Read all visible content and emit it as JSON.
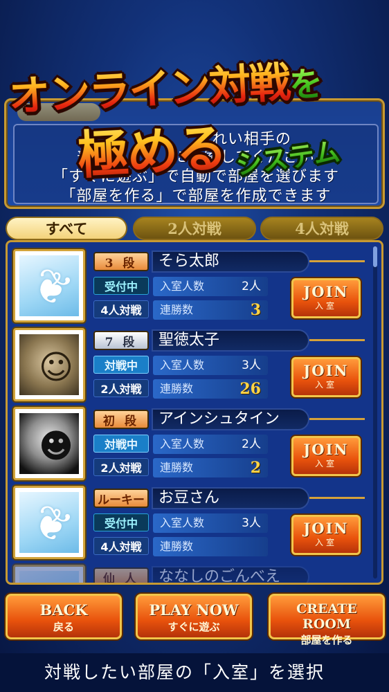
{
  "headline": {
    "line1": "オンライン対戦",
    "line1_particle": "を",
    "line2": "極める",
    "line3": "システム"
  },
  "info": {
    "lines": [
      "オ　　　　　　れい相手の",
      "部　　　　　に入室してください",
      "「すぐに遊ぶ」で自動で部屋を選びます",
      "「部屋を作る」で部屋を作成できます"
    ]
  },
  "tabs": [
    {
      "label": "すべて",
      "active": true
    },
    {
      "label": "2人対戦",
      "active": false
    },
    {
      "label": "4人対戦",
      "active": false
    }
  ],
  "rooms": [
    {
      "rank": "3 段",
      "rank_style": "orange",
      "name": "そら太郎",
      "status": "受付中",
      "status_type": "waiting",
      "mode": "4人対戦",
      "occupancy_label": "入室人数",
      "occupancy": "2人",
      "streak_label": "連勝数",
      "streak": "3",
      "join_en": "JOIN",
      "join_ja": "入室",
      "avatar": "feather"
    },
    {
      "rank": "7 段",
      "rank_style": "silver",
      "name": "聖徳太子",
      "status": "対戦中",
      "status_type": "playing",
      "mode": "2人対戦",
      "occupancy_label": "入室人数",
      "occupancy": "3人",
      "streak_label": "連勝数",
      "streak": "26",
      "join_en": "JOIN",
      "join_ja": "入室",
      "avatar": "portrait-a"
    },
    {
      "rank": "初 段",
      "rank_style": "orange",
      "name": "アインシュタイン",
      "status": "対戦中",
      "status_type": "playing",
      "mode": "2人対戦",
      "occupancy_label": "入室人数",
      "occupancy": "2人",
      "streak_label": "連勝数",
      "streak": "2",
      "join_en": "JOIN",
      "join_ja": "入室",
      "avatar": "portrait-b"
    },
    {
      "rank": "ルーキー",
      "rank_style": "orange",
      "name": "お豆さん",
      "status": "受付中",
      "status_type": "waiting",
      "mode": "4人対戦",
      "occupancy_label": "入室人数",
      "occupancy": "3人",
      "streak_label": "連勝数",
      "streak": "",
      "join_en": "JOIN",
      "join_ja": "入室",
      "avatar": "feather"
    },
    {
      "rank": "仙 人",
      "rank_style": "orange",
      "name": "ななしのごんべえ",
      "partial": true
    }
  ],
  "buttons": {
    "back_en": "BACK",
    "back_ja": "戻る",
    "play_en": "PLAY NOW",
    "play_ja": "すぐに遊ぶ",
    "create_en": "CREATE ROOM",
    "create_ja": "部屋を作る"
  },
  "footer": "対戦したい部屋の「入室」を選択"
}
